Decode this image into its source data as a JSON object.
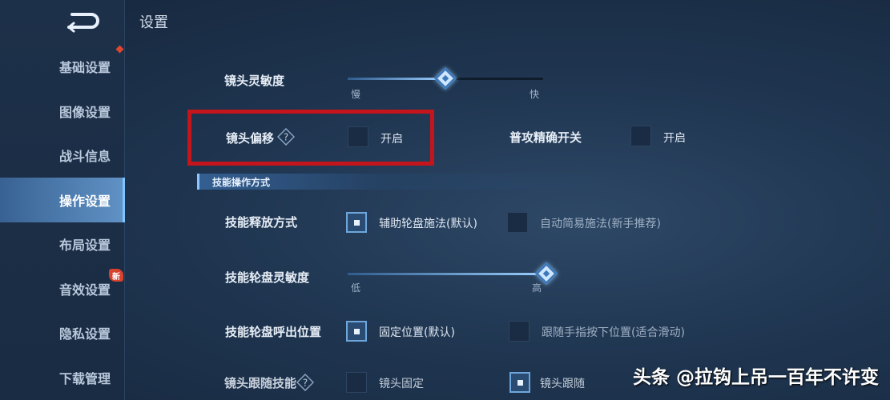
{
  "header": {
    "title": "设置"
  },
  "sidebar": {
    "items": [
      {
        "label": "基础设置"
      },
      {
        "label": "图像设置"
      },
      {
        "label": "战斗信息"
      },
      {
        "label": "操作设置"
      },
      {
        "label": "布局设置"
      },
      {
        "label": "音效设置"
      },
      {
        "label": "隐私设置"
      },
      {
        "label": "下载管理"
      }
    ],
    "active_index": 3,
    "new_badge": "新"
  },
  "settings": {
    "camera_sensitivity": {
      "label": "镜头灵敏度",
      "min_label": "慢",
      "max_label": "快",
      "value": 0.5
    },
    "camera_offset": {
      "label": "镜头偏移",
      "option": "开启",
      "checked": false
    },
    "precise_attack": {
      "label": "普攻精确开关",
      "option": "开启",
      "checked": false
    },
    "section_title": "技能操作方式",
    "skill_cast": {
      "label": "技能释放方式",
      "option1": "辅助轮盘施法(默认)",
      "option1_checked": true,
      "option2": "自动简易施法(新手推荐)",
      "option2_checked": false
    },
    "wheel_sensitivity": {
      "label": "技能轮盘灵敏度",
      "min_label": "低",
      "max_label": "高",
      "value": 1.0
    },
    "wheel_position": {
      "label": "技能轮盘呼出位置",
      "option1": "固定位置(默认)",
      "option1_checked": true,
      "option2": "跟随手指按下位置(适合滑动)",
      "option2_checked": false
    },
    "camera_follow": {
      "label": "镜头跟随技能",
      "option1": "镜头固定",
      "option1_checked": false,
      "option2": "镜头跟随",
      "option2_checked": true
    }
  },
  "watermark": "头条 @拉钩上吊一百年不许变",
  "colors": {
    "highlight": "#c4141c",
    "accent": "#6ea6dc",
    "background": "#1f3550"
  }
}
